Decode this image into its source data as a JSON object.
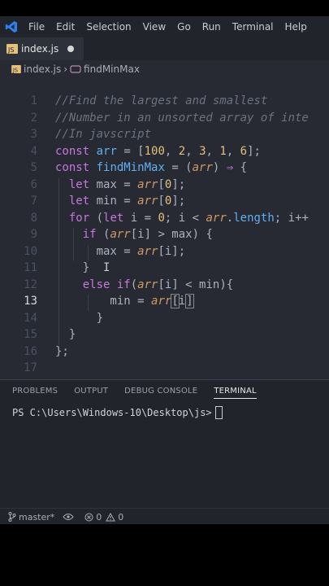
{
  "menu": [
    "File",
    "Edit",
    "Selection",
    "View",
    "Go",
    "Run",
    "Terminal",
    "Help"
  ],
  "tab": {
    "filename": "index.js"
  },
  "breadcrumb": {
    "file": "index.js",
    "symbol": "findMinMax"
  },
  "editor": {
    "line_numbers": [
      "1",
      "2",
      "3",
      "4",
      "5",
      "6",
      "7",
      "8",
      "9",
      "10",
      "11",
      "12",
      "13",
      "14",
      "15",
      "16",
      "17"
    ],
    "active_line": "13"
  },
  "panel": {
    "tabs": [
      "PROBLEMS",
      "OUTPUT",
      "DEBUG CONSOLE",
      "TERMINAL"
    ],
    "active_tab": "TERMINAL",
    "prompt": "PS C:\\Users\\Windows-10\\Desktop\\js>"
  },
  "status": {
    "branch": "master*",
    "errors": "0",
    "warnings": "0"
  },
  "colors": {
    "keyword": "#c678dd",
    "function": "#61afef",
    "number": "#e5c07b",
    "comment": "#6b7280",
    "param": "#d19a66",
    "logo": "#2f80ed"
  }
}
